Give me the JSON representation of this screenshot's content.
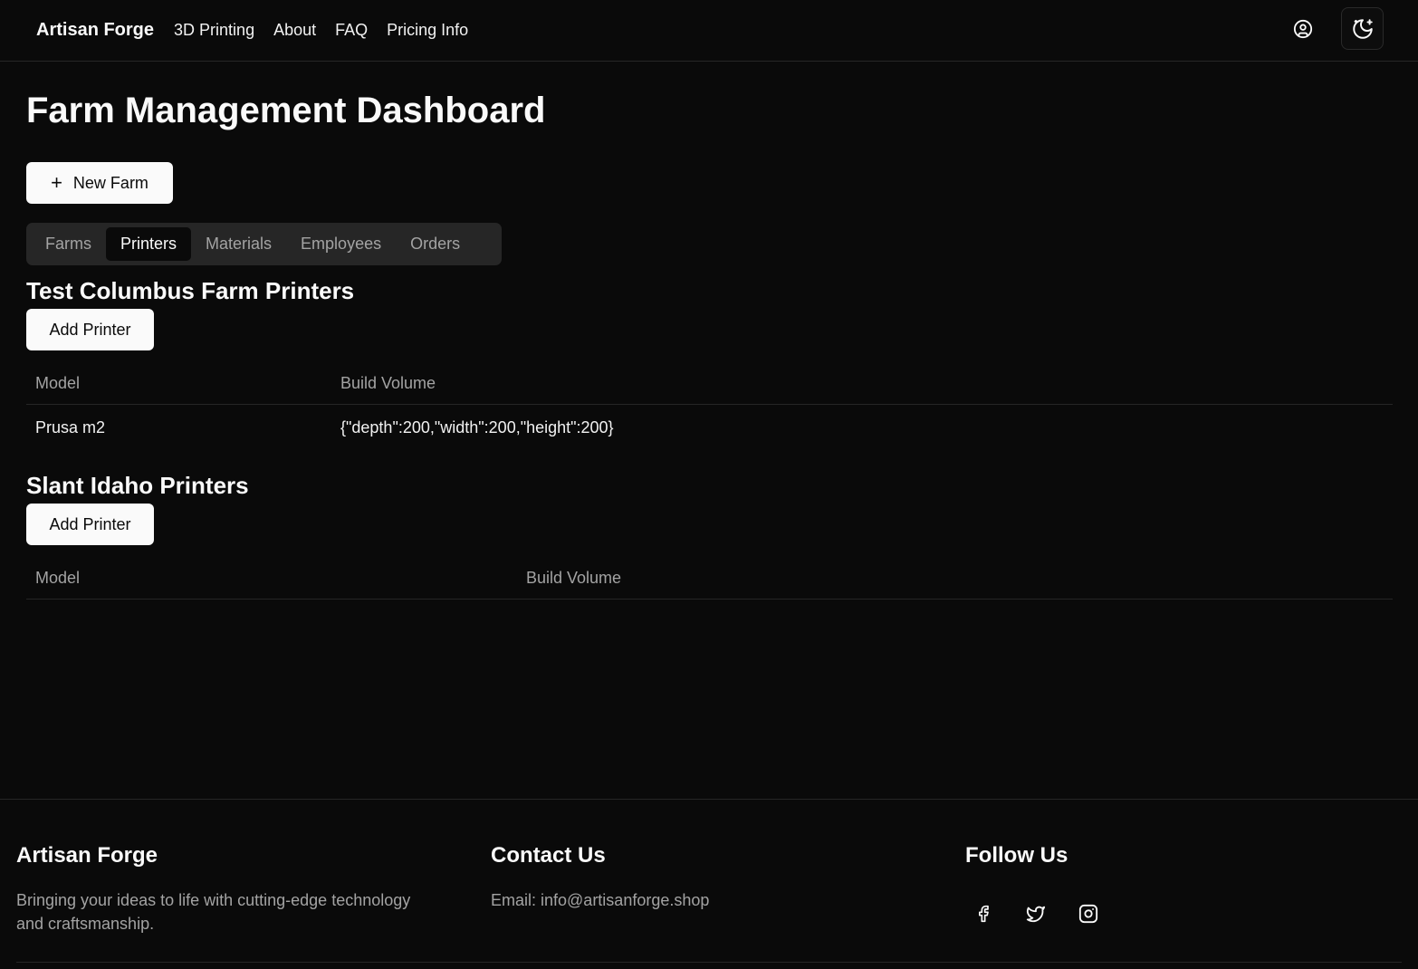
{
  "header": {
    "brand": "Artisan Forge",
    "nav": [
      "3D Printing",
      "About",
      "FAQ",
      "Pricing Info"
    ],
    "icons": {
      "user": "user-circle-icon",
      "theme": "moon-stars-icon"
    }
  },
  "main": {
    "title": "Farm Management Dashboard",
    "new_farm_label": "New Farm",
    "tabs": [
      {
        "label": "Farms",
        "active": false
      },
      {
        "label": "Printers",
        "active": true
      },
      {
        "label": "Materials",
        "active": false
      },
      {
        "label": "Employees",
        "active": false
      },
      {
        "label": "Orders",
        "active": false
      }
    ],
    "sections": [
      {
        "title": "Test Columbus Farm Printers",
        "add_label": "Add Printer",
        "columns": [
          "Model",
          "Build Volume"
        ],
        "rows": [
          {
            "model": "Prusa m2",
            "build_volume": "{\"depth\":200,\"width\":200,\"height\":200}"
          }
        ]
      },
      {
        "title": "Slant Idaho Printers",
        "add_label": "Add Printer",
        "columns": [
          "Model",
          "Build Volume"
        ],
        "rows": []
      }
    ]
  },
  "footer": {
    "about_heading": "Artisan Forge",
    "about_text_line1": "Bringing your ideas to life with cutting-edge technology",
    "about_text_line2": "and craftsmanship.",
    "contact_heading": "Contact Us",
    "contact_email": "Email: info@artisanforge.shop",
    "follow_heading": "Follow Us",
    "social_icons": [
      "facebook-icon",
      "twitter-icon",
      "instagram-icon"
    ]
  },
  "colors": {
    "background": "#0a0a0a",
    "foreground": "#fafafa",
    "muted": "#a3a3a3",
    "border": "#262626",
    "tab_track": "#262626"
  }
}
